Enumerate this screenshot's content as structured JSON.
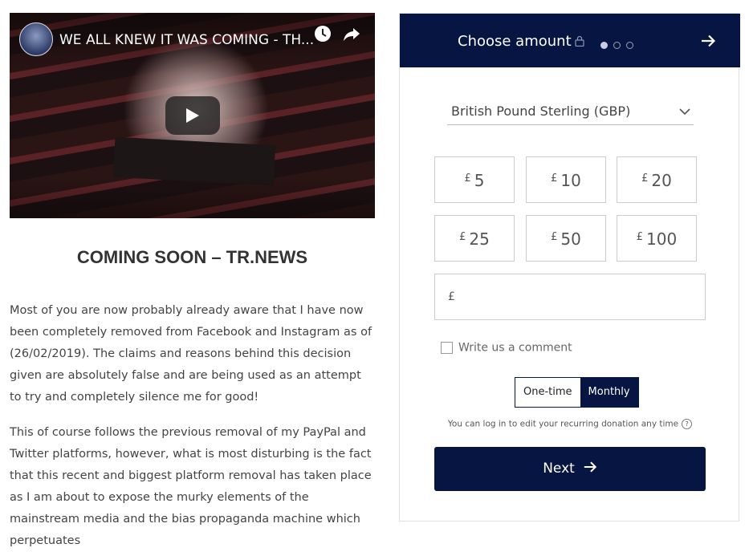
{
  "video": {
    "title": "WE ALL KNEW IT WAS COMING - TH..."
  },
  "article": {
    "heading": "COMING SOON – TR.NEWS",
    "paragraph1": "Most of you are now probably already aware that I have now been completely removed from Facebook and Instagram as of (26/02/2019).  The claims and reasons behind this decision given are absolutely false and are being used as an attempt to try and completely silence me for good!",
    "paragraph2": "This of course follows the previous removal of my PayPal and Twitter platforms, however, what is most disturbing is the fact that this recent and biggest platform removal has taken place as I am about to expose the murky elements of the mainstream media and the bias propaganda machine which perpetuates"
  },
  "donation": {
    "header_title": "Choose amount",
    "step_total": 3,
    "step_current": 1,
    "currency_select": "British Pound Sterling (GBP)",
    "currency_symbol": "£",
    "amounts": [
      "5",
      "10",
      "20",
      "25",
      "50",
      "100"
    ],
    "comment_label": "Write us a comment",
    "frequency": {
      "one_time": "One-time",
      "monthly": "Monthly",
      "selected": "Monthly"
    },
    "note": "You can log in to edit your recurring donation any time",
    "help_icon": "question-circle-icon",
    "next_label": "Next"
  },
  "colors": {
    "navy": "#061541"
  }
}
